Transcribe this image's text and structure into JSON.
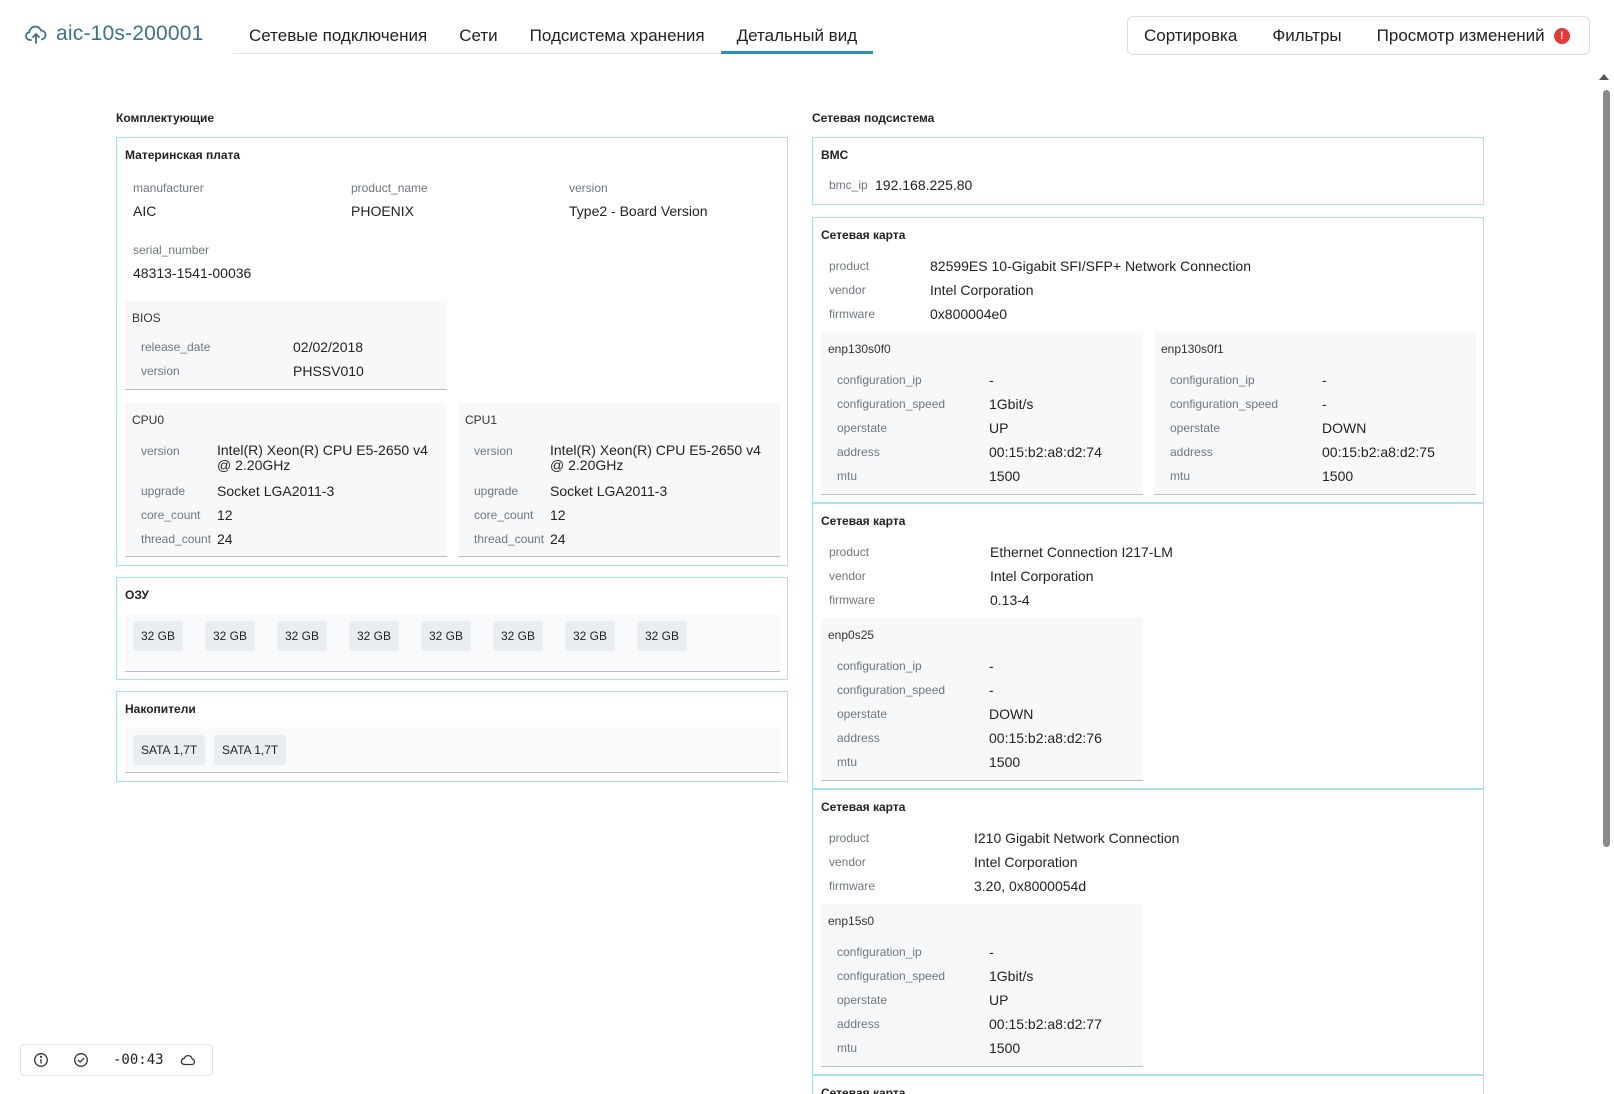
{
  "header": {
    "brand": "aic-10s-200001",
    "tabs": [
      "Сетевые подключения",
      "Сети",
      "Подсистема хранения",
      "Детальный вид"
    ],
    "active_tab": "Детальный вид",
    "actions": {
      "sort": "Сортировка",
      "filters": "Фильтры",
      "changes": "Просмотр изменений",
      "alert": "!"
    }
  },
  "components": {
    "title": "Комплектующие",
    "motherboard": {
      "title": "Материнская плата",
      "manufacturer_label": "manufacturer",
      "manufacturer": "AIC",
      "product_name_label": "product_name",
      "product_name": "PHOENIX",
      "version_label": "version",
      "version": "Type2 - Board Version",
      "serial_number_label": "serial_number",
      "serial_number": "48313-1541-00036"
    },
    "bios": {
      "title": "BIOS",
      "release_date_label": "release_date",
      "release_date": "02/02/2018",
      "version_label": "version",
      "version": "PHSSV010"
    },
    "cpus": [
      {
        "title": "CPU0",
        "version": "Intel(R) Xeon(R) CPU E5-2650 v4 @ 2.20GHz",
        "upgrade": "Socket LGA2011-3",
        "core_count": "12",
        "thread_count": "24"
      },
      {
        "title": "CPU1",
        "version": "Intel(R) Xeon(R) CPU E5-2650 v4 @ 2.20GHz",
        "upgrade": "Socket LGA2011-3",
        "core_count": "12",
        "thread_count": "24"
      }
    ],
    "cpu_labels": {
      "version": "version",
      "upgrade": "upgrade",
      "core_count": "core_count",
      "thread_count": "thread_count"
    },
    "ram": {
      "title": "ОЗУ",
      "modules": [
        "32 GB",
        "32 GB",
        "32 GB",
        "32 GB",
        "32 GB",
        "32 GB",
        "32 GB",
        "32 GB"
      ]
    },
    "storage": {
      "title": "Накопители",
      "drives": [
        "SATA 1,7T",
        "SATA 1,7T"
      ]
    }
  },
  "network": {
    "title": "Сетевая подсистема",
    "bmc": {
      "title": "BMC",
      "ip_label": "bmc_ip",
      "ip": "192.168.225.80"
    },
    "card_labels": {
      "product": "product",
      "vendor": "vendor",
      "firmware": "firmware"
    },
    "iface_labels": {
      "configuration_ip": "configuration_ip",
      "configuration_speed": "configuration_speed",
      "operstate": "operstate",
      "address": "address",
      "mtu": "mtu"
    },
    "cards": [
      {
        "title": "Сетевая карта",
        "product": "82599ES 10-Gigabit SFI/SFP+ Network Connection",
        "vendor": "Intel Corporation",
        "firmware": "0x800004e0",
        "interfaces": [
          {
            "name": "enp130s0f0",
            "configuration_ip": "-",
            "configuration_speed": "1Gbit/s",
            "operstate": "UP",
            "address": "00:15:b2:a8:d2:74",
            "mtu": "1500"
          },
          {
            "name": "enp130s0f1",
            "configuration_ip": "-",
            "configuration_speed": "-",
            "operstate": "DOWN",
            "address": "00:15:b2:a8:d2:75",
            "mtu": "1500"
          }
        ]
      },
      {
        "title": "Сетевая карта",
        "product": "Ethernet Connection I217-LM",
        "vendor": "Intel Corporation",
        "firmware": "0.13-4",
        "interfaces": [
          {
            "name": "enp0s25",
            "configuration_ip": "-",
            "configuration_speed": "-",
            "operstate": "DOWN",
            "address": "00:15:b2:a8:d2:76",
            "mtu": "1500"
          }
        ]
      },
      {
        "title": "Сетевая карта",
        "product": "I210 Gigabit Network Connection",
        "vendor": "Intel Corporation",
        "firmware": "3.20, 0x8000054d",
        "interfaces": [
          {
            "name": "enp15s0",
            "configuration_ip": "-",
            "configuration_speed": "1Gbit/s",
            "operstate": "UP",
            "address": "00:15:b2:a8:d2:77",
            "mtu": "1500"
          }
        ]
      },
      {
        "title": "Сетевая карта"
      }
    ]
  },
  "statusbar": {
    "timer": "-00:43",
    "icons": [
      "info-icon",
      "check-circle-icon",
      "cloud-icon"
    ]
  },
  "colors": {
    "accent": "#2d8fb8",
    "card_border": "#a8e3e8",
    "brand": "#3f7382",
    "alert": "#e53935"
  }
}
